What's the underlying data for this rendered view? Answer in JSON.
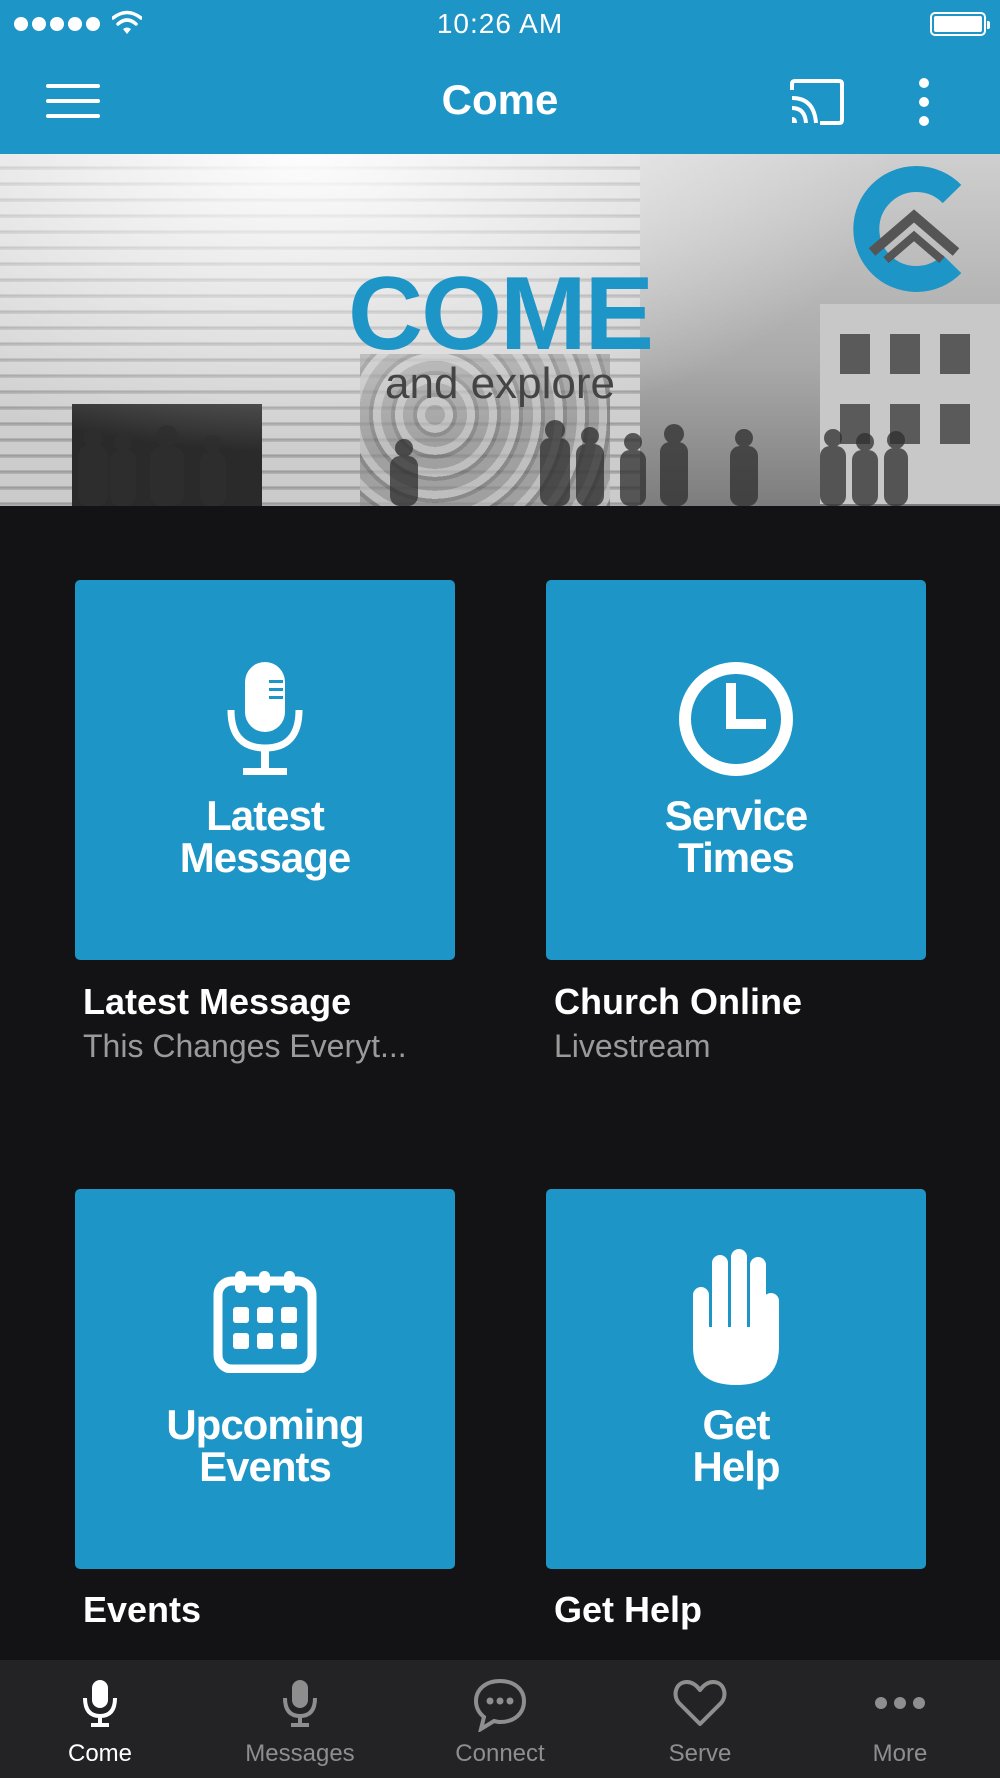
{
  "status_bar": {
    "time": "10:26 AM"
  },
  "app_bar": {
    "title": "Come"
  },
  "hero": {
    "title": "COME",
    "subtitle": "and explore"
  },
  "tiles": [
    {
      "tile_label_line1": "Latest",
      "tile_label_line2": "Message",
      "icon": "microphone-icon",
      "title": "Latest Message",
      "subtitle": "This Changes Everyt..."
    },
    {
      "tile_label_line1": "Service",
      "tile_label_line2": "Times",
      "icon": "clock-icon",
      "title": "Church Online",
      "subtitle": "Livestream"
    },
    {
      "tile_label_line1": "Upcoming",
      "tile_label_line2": "Events",
      "icon": "calendar-icon",
      "title": "Events",
      "subtitle": ""
    },
    {
      "tile_label_line1": "Get",
      "tile_label_line2": "Help",
      "icon": "hand-icon",
      "title": "Get Help",
      "subtitle": ""
    }
  ],
  "tab_bar": {
    "active_index": 0,
    "items": [
      {
        "label": "Come",
        "icon": "microphone-icon"
      },
      {
        "label": "Messages",
        "icon": "microphone-icon"
      },
      {
        "label": "Connect",
        "icon": "chat-bubble-icon"
      },
      {
        "label": "Serve",
        "icon": "heart-icon"
      },
      {
        "label": "More",
        "icon": "more-dots-icon"
      }
    ]
  },
  "colors": {
    "brand": "#1d95c6",
    "background": "#131315",
    "tab_bar": "#232325",
    "muted_text": "#9a9a9a"
  }
}
